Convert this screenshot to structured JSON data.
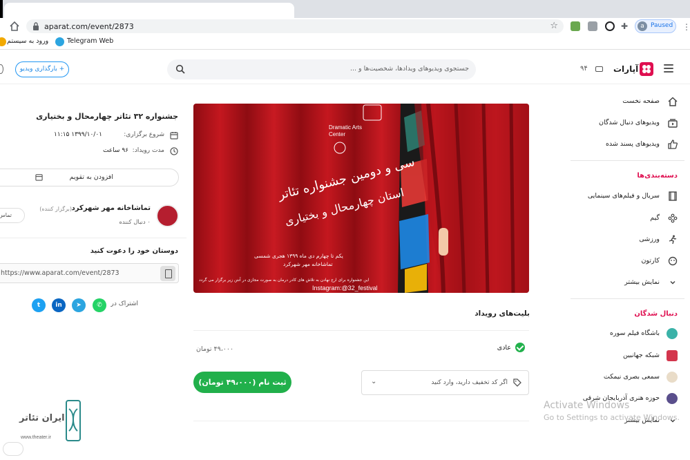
{
  "browser": {
    "url": "aparat.com/event/2873",
    "profile_initial": "a",
    "profile_status": "Paused",
    "bookmarks": [
      {
        "label": "ورود به سیستم"
      },
      {
        "label": "Telegram Web"
      }
    ]
  },
  "header": {
    "logo": "آپارات",
    "live_count": "۹۴",
    "search_placeholder": "جستجوی ویدیوهای ویدادها، شخصیت‌ها و ...",
    "upload_label": "+ بارگذاری ویدیو"
  },
  "sidebar": {
    "main_items": [
      {
        "label": "صفحه نخست",
        "icon": "home-icon"
      },
      {
        "label": "ویدیوهای دنبال شدگان",
        "icon": "subscriptions-icon"
      },
      {
        "label": "ویدیوهای پسند شده",
        "icon": "thumbs-up-icon"
      }
    ],
    "categories_title": "دسته‌بندی‌ها",
    "categories": [
      {
        "label": "سریال و فیلم‌های سینمایی",
        "icon": "film-icon"
      },
      {
        "label": "گیم",
        "icon": "gamepad-icon"
      },
      {
        "label": "ورزشی",
        "icon": "running-icon"
      },
      {
        "label": "کارتون",
        "icon": "cartoon-icon"
      },
      {
        "label": "نمایش بیشتر",
        "icon": "chevron-down-icon"
      }
    ],
    "followed_title": "دنبال شدگان",
    "followed": [
      {
        "label": "باشگاه فیلم سوره",
        "color": "#3bb2a8"
      },
      {
        "label": "شبکه جهانبین",
        "color": "#d3364d"
      },
      {
        "label": "سمعی بصری نیمکت",
        "color": "#e9dcc8"
      },
      {
        "label": "حوزه هنری آذربایجان شرقی",
        "color": "#5a4f8c"
      },
      {
        "label": "نمایش بیشتر",
        "color": ""
      }
    ]
  },
  "banner": {
    "line1": "سی و دومین جشنواره تئاتر",
    "line2": "استان چهارمحال و بختیاری",
    "dates": "یکم تا چهارم دی ماه ۱۳۹۹ هجری شمسی",
    "venue": "تماشاخانه مهر شهرکرد",
    "note": "این جشنواره برای ارج نهادن به تلاش های کادر درمان به صورت مجازی در آنتن زیر برگزار می گردد",
    "instagram": "Instagram:@32_festival",
    "logo_text": "Dramatic Arts Center",
    "colors": {
      "curtain": "#b5141b",
      "curtain_dark": "#7a0a10"
    }
  },
  "tickets": {
    "title": "بلیت‌های رویداد",
    "type": "عادی",
    "price": "۴۹،۰۰۰ تومان",
    "discount_placeholder": "اگر کد تخفیف دارید، وارد کنید",
    "register_label": "ثبت نام (۴۹،۰۰۰ تومان)"
  },
  "event": {
    "title": "جشنواره ۳۲ تئاتر چهارمحال و بختیاری",
    "start_label": "شروع برگزاری:",
    "start_value": "۱۳۹۹/۱۰/۰۱ ۱۱:۱۵",
    "duration_label": "مدت رویداد:",
    "duration_value": "۹۶ ساعت",
    "calendar_label": "افزودن به تقویم",
    "organizer_name": "تماشاخانه مهر شهرکرد",
    "organizer_role": "(برگزار کننده)",
    "organizer_followers": "۰ دنبال کننده",
    "contact_label": "تماس",
    "invite_title": "دوستان خود را دعوت کنید",
    "share_link": "https://www.aparat.com/event/2873",
    "share_label": "اشتراک در",
    "share_networks": [
      {
        "name": "whatsapp",
        "glyph": "✆",
        "color": "#25d366"
      },
      {
        "name": "telegram",
        "glyph": "➤",
        "color": "#2ca5e0"
      },
      {
        "name": "linkedin",
        "glyph": "in",
        "color": "#0a66c2"
      },
      {
        "name": "twitter",
        "glyph": "t",
        "color": "#1da1f2"
      }
    ]
  },
  "watermark": {
    "activate_title": "Activate Windows",
    "activate_sub": "Go to Settings to activate Windows.",
    "site_logo": "ایران تئاتر",
    "site_url": "www.theater.ir"
  }
}
